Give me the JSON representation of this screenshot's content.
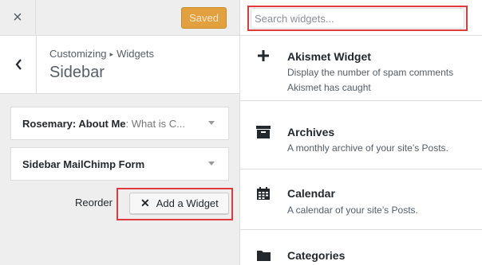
{
  "topbar": {
    "close_glyph": "×",
    "saved_label": "Saved"
  },
  "header": {
    "breadcrumb_parent": "Customizing",
    "breadcrumb_arrow": "▸",
    "breadcrumb_current": "Widgets",
    "title": "Sidebar"
  },
  "sidebar_widgets": [
    {
      "name": "Rosemary: About Me",
      "subtitle": ": What is C..."
    },
    {
      "name": "Sidebar MailChimp Form",
      "subtitle": ""
    }
  ],
  "actions": {
    "reorder_label": "Reorder",
    "add_widget_label": "Add a Widget"
  },
  "search": {
    "placeholder": "Search widgets...",
    "value": ""
  },
  "available_widgets": [
    {
      "icon": "plus-icon",
      "name": "Akismet Widget",
      "description": "Display the number of spam comments Akismet has caught"
    },
    {
      "icon": "archive-icon",
      "name": "Archives",
      "description": "A monthly archive of your site’s Posts."
    },
    {
      "icon": "calendar-icon",
      "name": "Calendar",
      "description": "A calendar of your site’s Posts."
    },
    {
      "icon": "folder-icon",
      "name": "Categories",
      "description": ""
    }
  ],
  "colors": {
    "saved_bg": "#e2a03e",
    "highlight": "#e03a3e"
  }
}
